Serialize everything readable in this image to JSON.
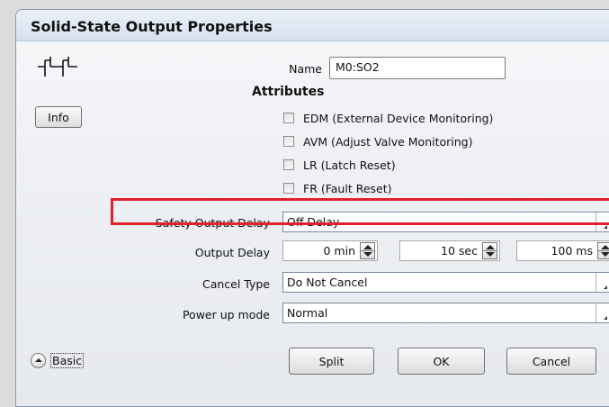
{
  "dialog": {
    "title": "Solid-State Output Properties",
    "info_button": "Info",
    "name_label": "Name",
    "name_value": "M0:SO2",
    "attributes_heading": "Attributes",
    "attributes": [
      {
        "label": "EDM (External Device Monitoring)",
        "checked": false
      },
      {
        "label": "AVM (Adjust Valve Monitoring)",
        "checked": false
      },
      {
        "label": "LR (Latch Reset)",
        "checked": false
      },
      {
        "label": "FR (Fault Reset)",
        "checked": false
      }
    ],
    "safety_output_delay": {
      "label": "Safety Output Delay",
      "value": "Off Delay"
    },
    "output_delay": {
      "label": "Output Delay",
      "min": "0 min",
      "sec": "10 sec",
      "ms": "100 ms"
    },
    "cancel_type": {
      "label": "Cancel Type",
      "value": "Do Not Cancel"
    },
    "power_up_mode": {
      "label": "Power up mode",
      "value": "Normal"
    },
    "basic_button": "Basic",
    "buttons": {
      "split": "Split",
      "ok": "OK",
      "cancel": "Cancel"
    },
    "highlight_color": "#e0202a"
  }
}
